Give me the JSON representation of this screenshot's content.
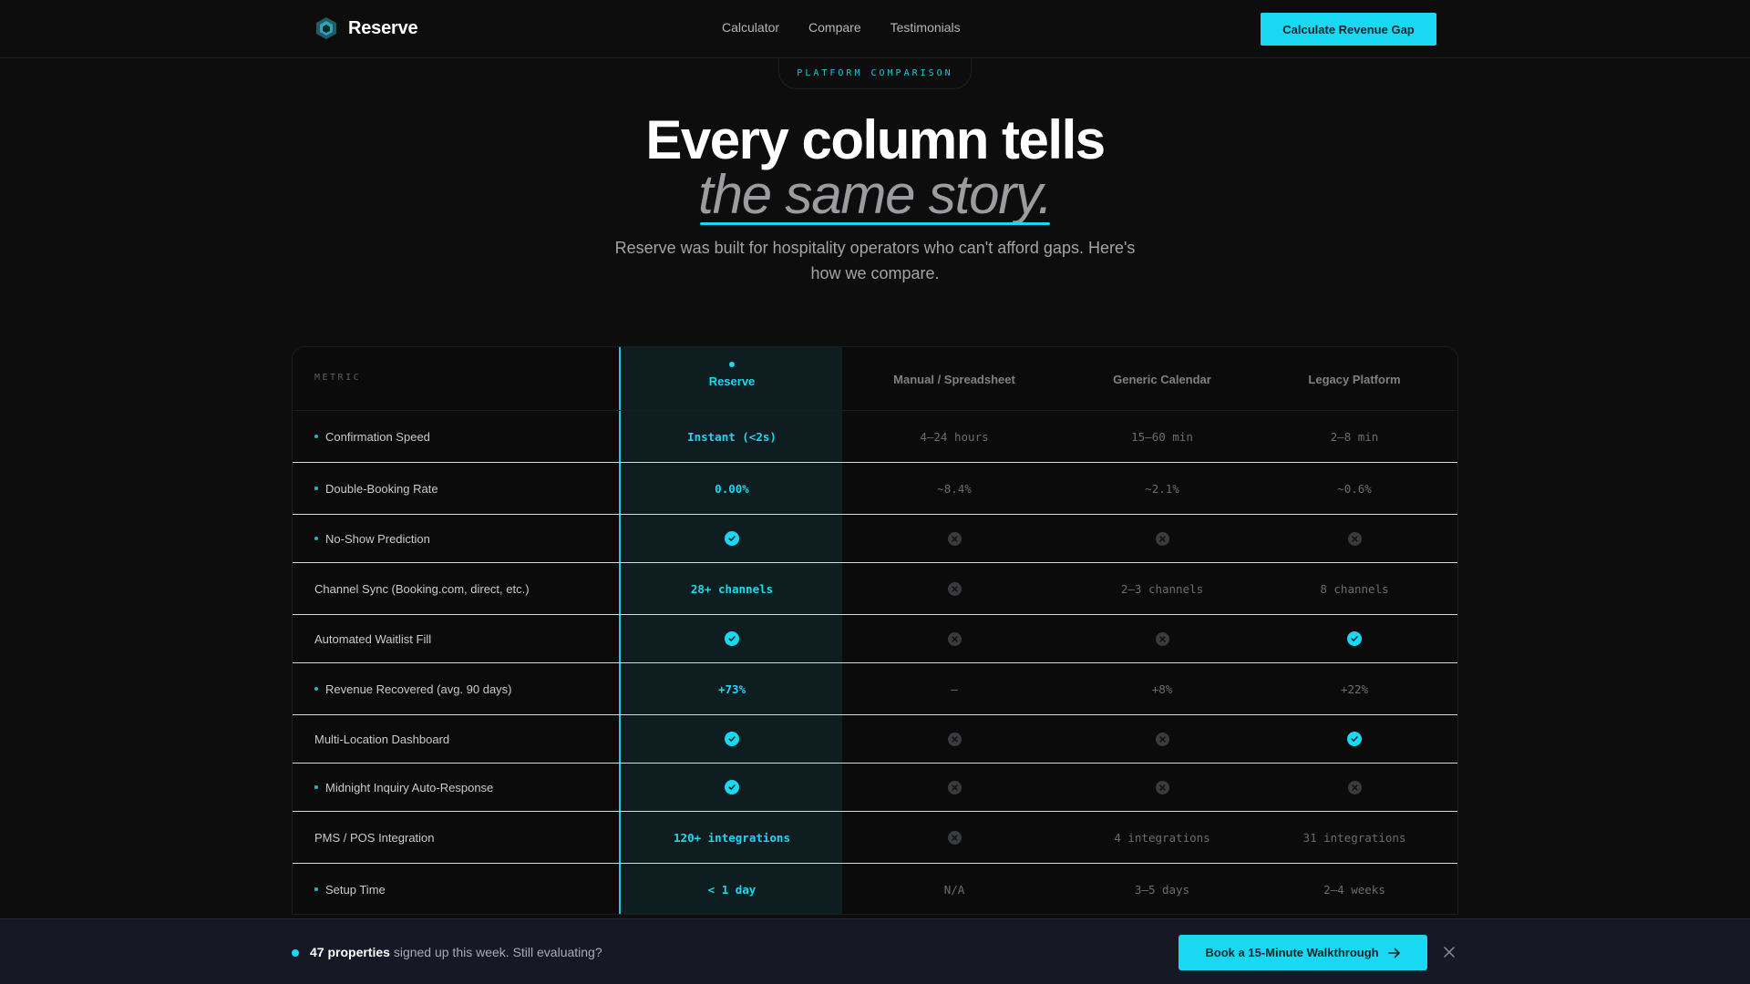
{
  "nav": {
    "brand": "Reserve",
    "links": [
      "Calculator",
      "Compare",
      "Testimonials"
    ],
    "cta": "Calculate Revenue Gap"
  },
  "hero": {
    "eyebrow": "PLATFORM COMPARISON",
    "title_line1": "Every column tells",
    "title_line2": "the same story.",
    "subtitle": "Reserve was built for hospitality operators who can't afford gaps. Here's how we compare."
  },
  "table": {
    "metric_header": "METRIC",
    "columns": [
      "Reserve",
      "Manual / Spreadsheet",
      "Generic Calendar",
      "Legacy Platform"
    ],
    "rows": [
      {
        "metric": "Confirmation Speed",
        "highlight": true,
        "cells": [
          "Instant (<2s)",
          "4–24 hours",
          "15–60 min",
          "2–8 min"
        ]
      },
      {
        "metric": "Double-Booking Rate",
        "highlight": true,
        "cells": [
          "0.00%",
          "~8.4%",
          "~2.1%",
          "~0.6%"
        ]
      },
      {
        "metric": "No-Show Prediction",
        "highlight": true,
        "cells": [
          "check",
          "x",
          "x",
          "x"
        ]
      },
      {
        "metric": "Channel Sync (Booking.com, direct, etc.)",
        "highlight": false,
        "cells": [
          "28+ channels",
          "x",
          "2–3 channels",
          "8 channels"
        ]
      },
      {
        "metric": "Automated Waitlist Fill",
        "highlight": false,
        "cells": [
          "check",
          "x",
          "x",
          "check"
        ]
      },
      {
        "metric": "Revenue Recovered (avg. 90 days)",
        "highlight": true,
        "cells": [
          "+73%",
          "—",
          "+8%",
          "+22%"
        ]
      },
      {
        "metric": "Multi-Location Dashboard",
        "highlight": false,
        "cells": [
          "check",
          "x",
          "x",
          "check"
        ]
      },
      {
        "metric": "Midnight Inquiry Auto-Response",
        "highlight": true,
        "cells": [
          "check",
          "x",
          "x",
          "x"
        ]
      },
      {
        "metric": "PMS / POS Integration",
        "highlight": false,
        "cells": [
          "120+ integrations",
          "x",
          "4 integrations",
          "31 integrations"
        ]
      },
      {
        "metric": "Setup Time",
        "highlight": true,
        "cells": [
          "< 1 day",
          "N/A",
          "3–5 days",
          "2–4 weeks"
        ]
      }
    ]
  },
  "bottom_bar": {
    "count_bold": "47 properties",
    "text": " signed up this week. Still evaluating?",
    "cta": "Book a 15-Minute Walkthrough"
  },
  "colors": {
    "accent": "#19d9f2",
    "background": "#0d0d0e",
    "bottom_bar": "#171826"
  },
  "icons": {
    "brand": "hexagon-logo-icon",
    "check": "check-circle-icon",
    "x": "x-circle-icon",
    "arrow": "arrow-right-icon",
    "close": "close-icon"
  }
}
